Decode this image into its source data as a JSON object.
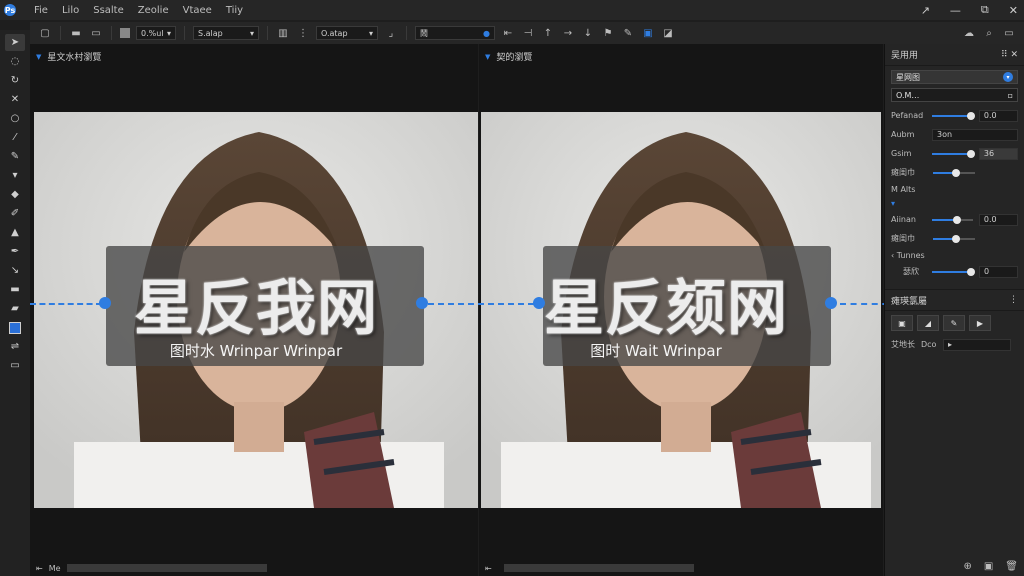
{
  "menu": {
    "items": [
      "Fie",
      "Lilo",
      "Ssalte",
      "Zeolie",
      "Vtaee",
      "Tiiy"
    ],
    "window_controls": [
      "↗",
      "—",
      "⧉",
      "✕"
    ]
  },
  "optionsbar": {
    "field1": "0.%ul",
    "field2": "S.alap",
    "field3": "O.atap",
    "field4": "鬧"
  },
  "docs": [
    {
      "tab": "星文水村瀏覽",
      "watermark_big": "星反我网",
      "watermark_small": "图时水 Wrinpar Wrinpar",
      "status_label": "Me"
    },
    {
      "tab": "契的瀏覽",
      "watermark_big": "星反颏网",
      "watermark_small": "图时 Wait Wrinpar",
      "status_label": ""
    }
  ],
  "panel": {
    "title": "吴用用",
    "preset": "星网图",
    "sub_select": "O.M…",
    "rows": [
      {
        "label": "Pefanad",
        "value": "0.0",
        "level": 0.95
      },
      {
        "label": "Aubm",
        "value": "3on",
        "level": null
      },
      {
        "label": "Gsim",
        "value": "36",
        "level": 0.95
      },
      {
        "label": "瘫闺巾",
        "value": "",
        "level": 0.55
      }
    ],
    "section1": "M Alts",
    "rows2": [
      {
        "label": "Aiinan",
        "value": "0.0",
        "level": 0.6
      },
      {
        "label": "瘫闺巾",
        "value": "",
        "level": 0.55
      }
    ],
    "section2": "Tunnes",
    "row3": {
      "label": "瑟欣",
      "value": "0",
      "level": 0.95
    },
    "section3": "瘫瑛氯屬",
    "last_row": {
      "label": "艾地长",
      "value": "Dco"
    }
  },
  "colors": {
    "accent": "#2f7de1",
    "bg": "#1e1e1e",
    "panel": "#252525"
  }
}
